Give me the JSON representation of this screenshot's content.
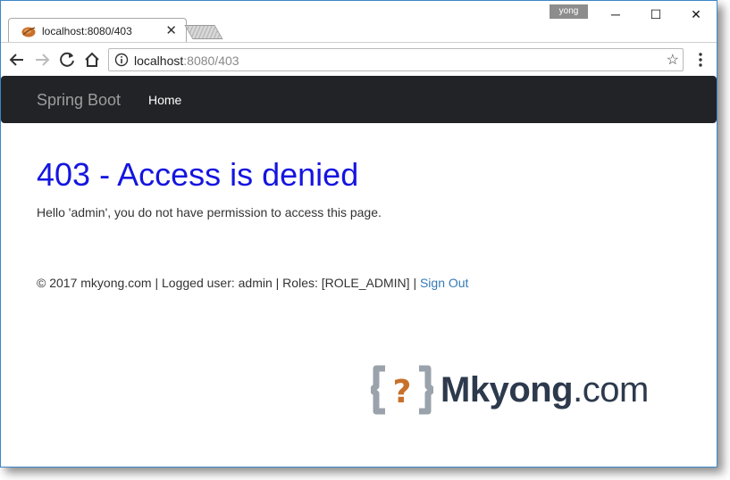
{
  "browser": {
    "tab_title": "localhost:8080/403",
    "tab_close": "✕",
    "user_badge": "yong",
    "url_host": "localhost",
    "url_path": ":8080/403",
    "star": "☆"
  },
  "window_controls": {
    "minimize": "─",
    "maximize": "☐",
    "close": "✕"
  },
  "navbar": {
    "brand": "Spring Boot",
    "home": "Home"
  },
  "page": {
    "heading": "403 - Access is denied",
    "message": "Hello 'admin', you do not have permission to access this page."
  },
  "footer": {
    "text": "© 2017 mkyong.com | Logged user: admin | Roles: [ROLE_ADMIN] | ",
    "sign_out": "Sign Out"
  },
  "logo": {
    "name": "Mkyong",
    "suffix": ".com",
    "glyph": "?"
  },
  "colors": {
    "heading": "#1515e0",
    "navbar_bg": "#222327",
    "link": "#337ab7",
    "logo_orange": "#c8702a"
  }
}
